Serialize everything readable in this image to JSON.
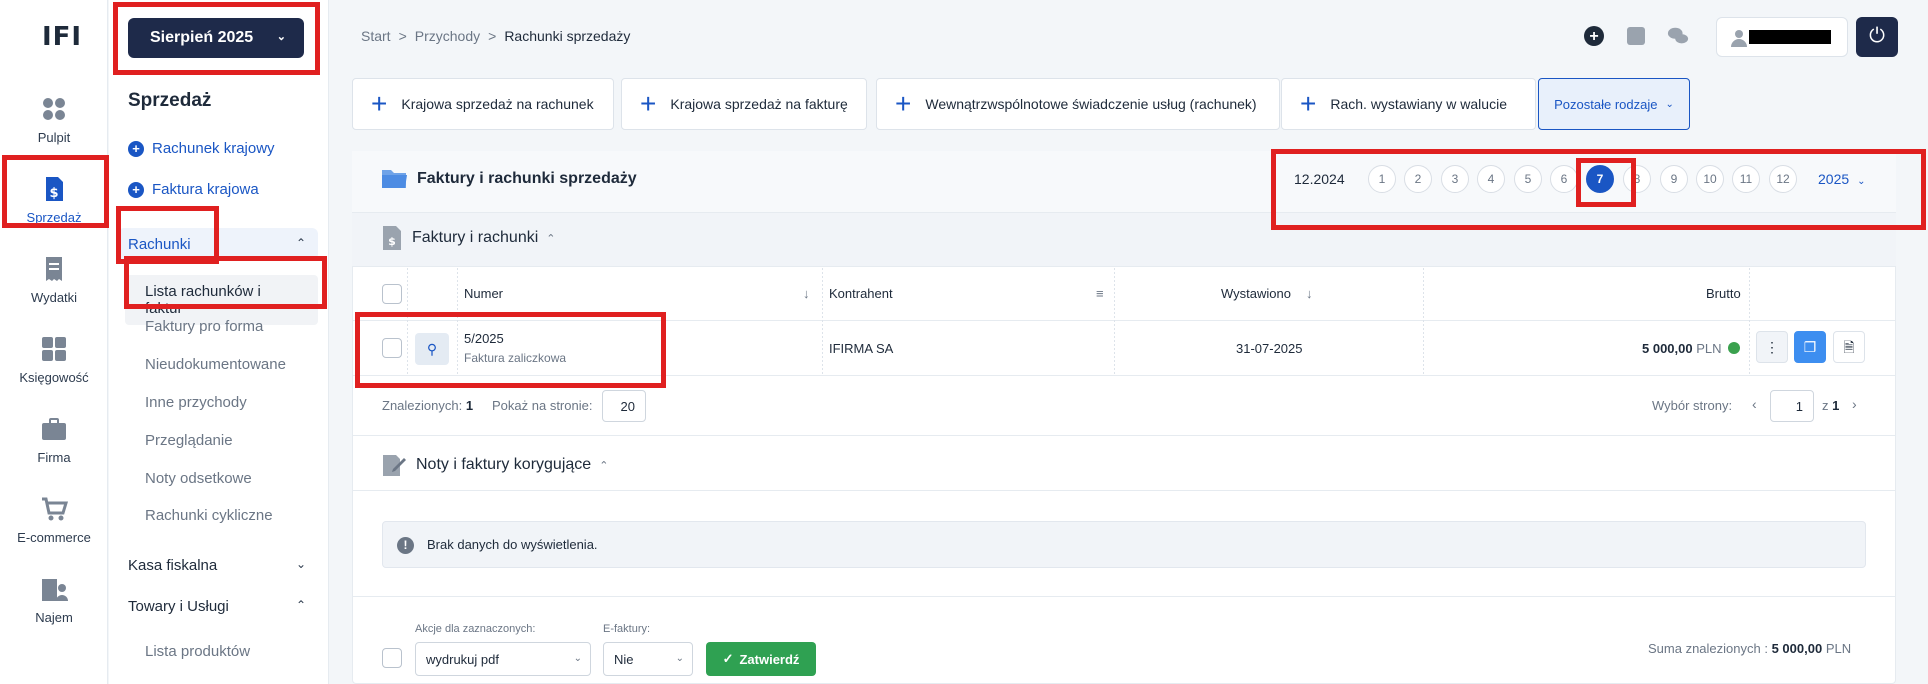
{
  "app": {
    "logo_text": "IFI"
  },
  "rail": {
    "items": [
      {
        "label": "Pulpit",
        "icon": "grid-icon"
      },
      {
        "label": "Sprzedaż",
        "icon": "invoice-dollar-icon"
      },
      {
        "label": "Wydatki",
        "icon": "receipt-icon"
      },
      {
        "label": "Księgowość",
        "icon": "calculator-icon"
      },
      {
        "label": "Firma",
        "icon": "briefcase-icon"
      },
      {
        "label": "E-commerce",
        "icon": "cart-icon"
      },
      {
        "label": "Najem",
        "icon": "building-person-icon"
      }
    ]
  },
  "subnav": {
    "month": "Sierpień 2025",
    "title": "Sprzedaż",
    "quick": [
      "Rachunek krajowy",
      "Faktura krajowa"
    ],
    "groups": {
      "rachunki": "Rachunki",
      "kasa": "Kasa fiskalna",
      "towary": "Towary i Usługi"
    },
    "rachunki_items": [
      "Lista rachunków i faktur",
      "Faktury pro forma",
      "Nieudokumentowane",
      "Inne przychody",
      "Przeglądanie",
      "Noty odsetkowe",
      "Rachunki cykliczne"
    ],
    "towary_items": [
      "Lista produktów"
    ]
  },
  "breadcrumb": {
    "start": "Start",
    "przychody": "Przychody",
    "current": "Rachunki sprzedaży",
    "sep": ">"
  },
  "types": [
    "Krajowa sprzedaż na rachunek",
    "Krajowa sprzedaż na fakturę",
    "Wewnątrzwspólnotowe świadczenie usług (rachunek)",
    "Rach. wystawiany w walucie"
  ],
  "types_other": "Pozostałe rodzaje",
  "panel": {
    "title": "Faktury i rachunki sprzedaży",
    "prev_period": "12.2024",
    "months": [
      "1",
      "2",
      "3",
      "4",
      "5",
      "6",
      "7",
      "8",
      "9",
      "10",
      "11",
      "12"
    ],
    "active_month": "7",
    "year": "2025"
  },
  "section1": {
    "title": "Faktury i rachunki"
  },
  "table": {
    "headers": {
      "numer": "Numer",
      "kontrahent": "Kontrahent",
      "wystawiono": "Wystawiono",
      "brutto": "Brutto"
    },
    "rows": [
      {
        "numer": "5/2025",
        "typ": "Faktura zaliczkowa",
        "kontrahent": "IFIRMA SA",
        "wystawiono": "31-07-2025",
        "brutto": "5 000,00",
        "waluta": "PLN"
      }
    ]
  },
  "list_footer": {
    "found_label": "Znalezionych:",
    "found": "1",
    "per_page_label": "Pokaż na stronie:",
    "per_page": "20",
    "page_select_label": "Wybór strony:",
    "page": "1",
    "of": "z",
    "total_pages": "1"
  },
  "section2": {
    "title": "Noty i faktury korygujące",
    "empty": "Brak danych do wyświetlenia."
  },
  "bottom": {
    "actions_label": "Akcje dla zaznaczonych:",
    "action_value": "wydrukuj pdf",
    "efaktury_label": "E-faktury:",
    "efaktury_value": "Nie",
    "confirm": "Zatwierdź",
    "sum_label": "Suma znalezionych :",
    "sum_value": "5 000,00",
    "sum_currency": "PLN"
  }
}
